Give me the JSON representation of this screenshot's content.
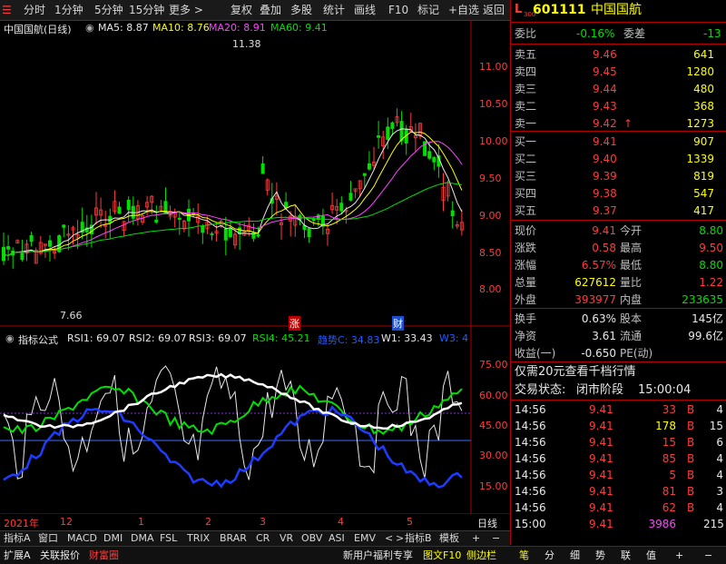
{
  "toolbar": {
    "items": [
      "分时",
      "1分钟",
      "5分钟",
      "15分钟",
      "更多 >",
      "复权",
      "叠加",
      "多股",
      "统计",
      "画线",
      "F10",
      "标记",
      "+自选",
      "返回"
    ]
  },
  "colors": {
    "up": "#ff3b3b",
    "down": "#00e000",
    "flat": "#e8e8e8",
    "ma5": "#e8e8e8",
    "ma10": "#ffff00",
    "ma20": "#ff44ff",
    "ma60": "#00e000"
  },
  "kline": {
    "title": "中国国航(日线)",
    "ma_labels": [
      "MA5: 8.87",
      "MA10: 8.76",
      "MA20: 8.91",
      "MA60: 9.41"
    ],
    "y_ticks": [
      "11.00",
      "10.50",
      "10.00",
      "9.50",
      "9.00",
      "8.50",
      "8.00"
    ],
    "high_label": "11.38",
    "low_label": "7.66",
    "marker_up": "涨",
    "marker_fin": "财"
  },
  "indicator": {
    "title": "指标公式",
    "labels": [
      "RSI1: 69.07",
      "RSI2: 69.07",
      "RSI3: 69.07",
      "RSI4: 45.21",
      "趋势C: 34.83",
      "W1: 33.43",
      "W3: 4"
    ],
    "y_ticks": [
      "75.00",
      "60.00",
      "45.00",
      "30.00",
      "15.00"
    ]
  },
  "x_axis": {
    "labels": [
      "2021年",
      "12",
      "1",
      "2",
      "3",
      "4",
      "5"
    ],
    "right_label": "日线"
  },
  "bottom_tabs": [
    "指标A",
    "窗口",
    "MACD",
    "DMI",
    "DMA",
    "FSL",
    "TRIX",
    "BRAR",
    "CR",
    "VR",
    "OBV",
    "ASI",
    "EMV",
    "<",
    ">",
    "指标B",
    "模板"
  ],
  "status_bar": [
    "扩展A",
    "关联报价",
    "财富圈",
    "新用户福利专享",
    "图文F10",
    "侧边栏"
  ],
  "status_icons": [
    "笔",
    "分",
    "细",
    "势",
    "联",
    "值",
    "+",
    "−"
  ],
  "stock": {
    "code": "601111",
    "name": "中国国航",
    "badge_top": "L",
    "badge_bottom": "300",
    "webi_label": "委比",
    "webi_value": "-0.16%",
    "weicha_label": "委差",
    "weicha_value": "-13"
  },
  "asks": [
    {
      "label": "卖五",
      "price": "9.46",
      "vol": "641"
    },
    {
      "label": "卖四",
      "price": "9.45",
      "vol": "1280"
    },
    {
      "label": "卖三",
      "price": "9.44",
      "vol": "480"
    },
    {
      "label": "卖二",
      "price": "9.43",
      "vol": "368"
    },
    {
      "label": "卖一",
      "price": "9.42",
      "vol": "1273",
      "arrow": "↑"
    }
  ],
  "bids": [
    {
      "label": "买一",
      "price": "9.41",
      "vol": "907"
    },
    {
      "label": "买二",
      "price": "9.40",
      "vol": "1339"
    },
    {
      "label": "买三",
      "price": "9.39",
      "vol": "819"
    },
    {
      "label": "买四",
      "price": "9.38",
      "vol": "547"
    },
    {
      "label": "买五",
      "price": "9.37",
      "vol": "417"
    }
  ],
  "quote": [
    {
      "l1": "现价",
      "v1": "9.41",
      "c1": "red",
      "l2": "今开",
      "v2": "8.80",
      "c2": "green"
    },
    {
      "l1": "涨跌",
      "v1": "0.58",
      "c1": "red",
      "l2": "最高",
      "v2": "9.50",
      "c2": "red"
    },
    {
      "l1": "涨幅",
      "v1": "6.57%",
      "c1": "red",
      "l2": "最低",
      "v2": "8.80",
      "c2": "green"
    },
    {
      "l1": "总量",
      "v1": "627612",
      "c1": "yellow",
      "l2": "量比",
      "v2": "1.22",
      "c2": "red"
    },
    {
      "l1": "外盘",
      "v1": "393977",
      "c1": "red",
      "l2": "内盘",
      "v2": "233635",
      "c2": "green"
    }
  ],
  "fundamentals": [
    {
      "l1": "换手",
      "v1": "0.63%",
      "l2": "股本",
      "v2": "145亿"
    },
    {
      "l1": "净资",
      "v1": "3.61",
      "l2": "流通",
      "v2": "99.6亿"
    },
    {
      "l1": "收益(一)",
      "v1": "-0.650",
      "l2": "PE(动)",
      "v2": ""
    }
  ],
  "promo": "仅需20元查看千档行情",
  "trade_status_label": "交易状态:",
  "trade_status_value": "闭市阶段",
  "trade_status_time": "15:00:04",
  "ticks": [
    {
      "time": "14:56",
      "price": "9.41",
      "vol": "33",
      "side": "B",
      "n": "4",
      "vc": "red"
    },
    {
      "time": "14:56",
      "price": "9.41",
      "vol": "178",
      "side": "B",
      "n": "15",
      "vc": "yellow"
    },
    {
      "time": "14:56",
      "price": "9.41",
      "vol": "15",
      "side": "B",
      "n": "6",
      "vc": "red"
    },
    {
      "time": "14:56",
      "price": "9.41",
      "vol": "85",
      "side": "B",
      "n": "4",
      "vc": "red"
    },
    {
      "time": "14:56",
      "price": "9.41",
      "vol": "5",
      "side": "B",
      "n": "4",
      "vc": "red"
    },
    {
      "time": "14:56",
      "price": "9.41",
      "vol": "81",
      "side": "B",
      "n": "3",
      "vc": "red"
    },
    {
      "time": "14:56",
      "price": "9.41",
      "vol": "62",
      "side": "B",
      "n": "4",
      "vc": "red"
    },
    {
      "time": "15:00",
      "price": "9.41",
      "vol": "3986",
      "side": "",
      "n": "215",
      "vc": "magenta"
    }
  ]
}
